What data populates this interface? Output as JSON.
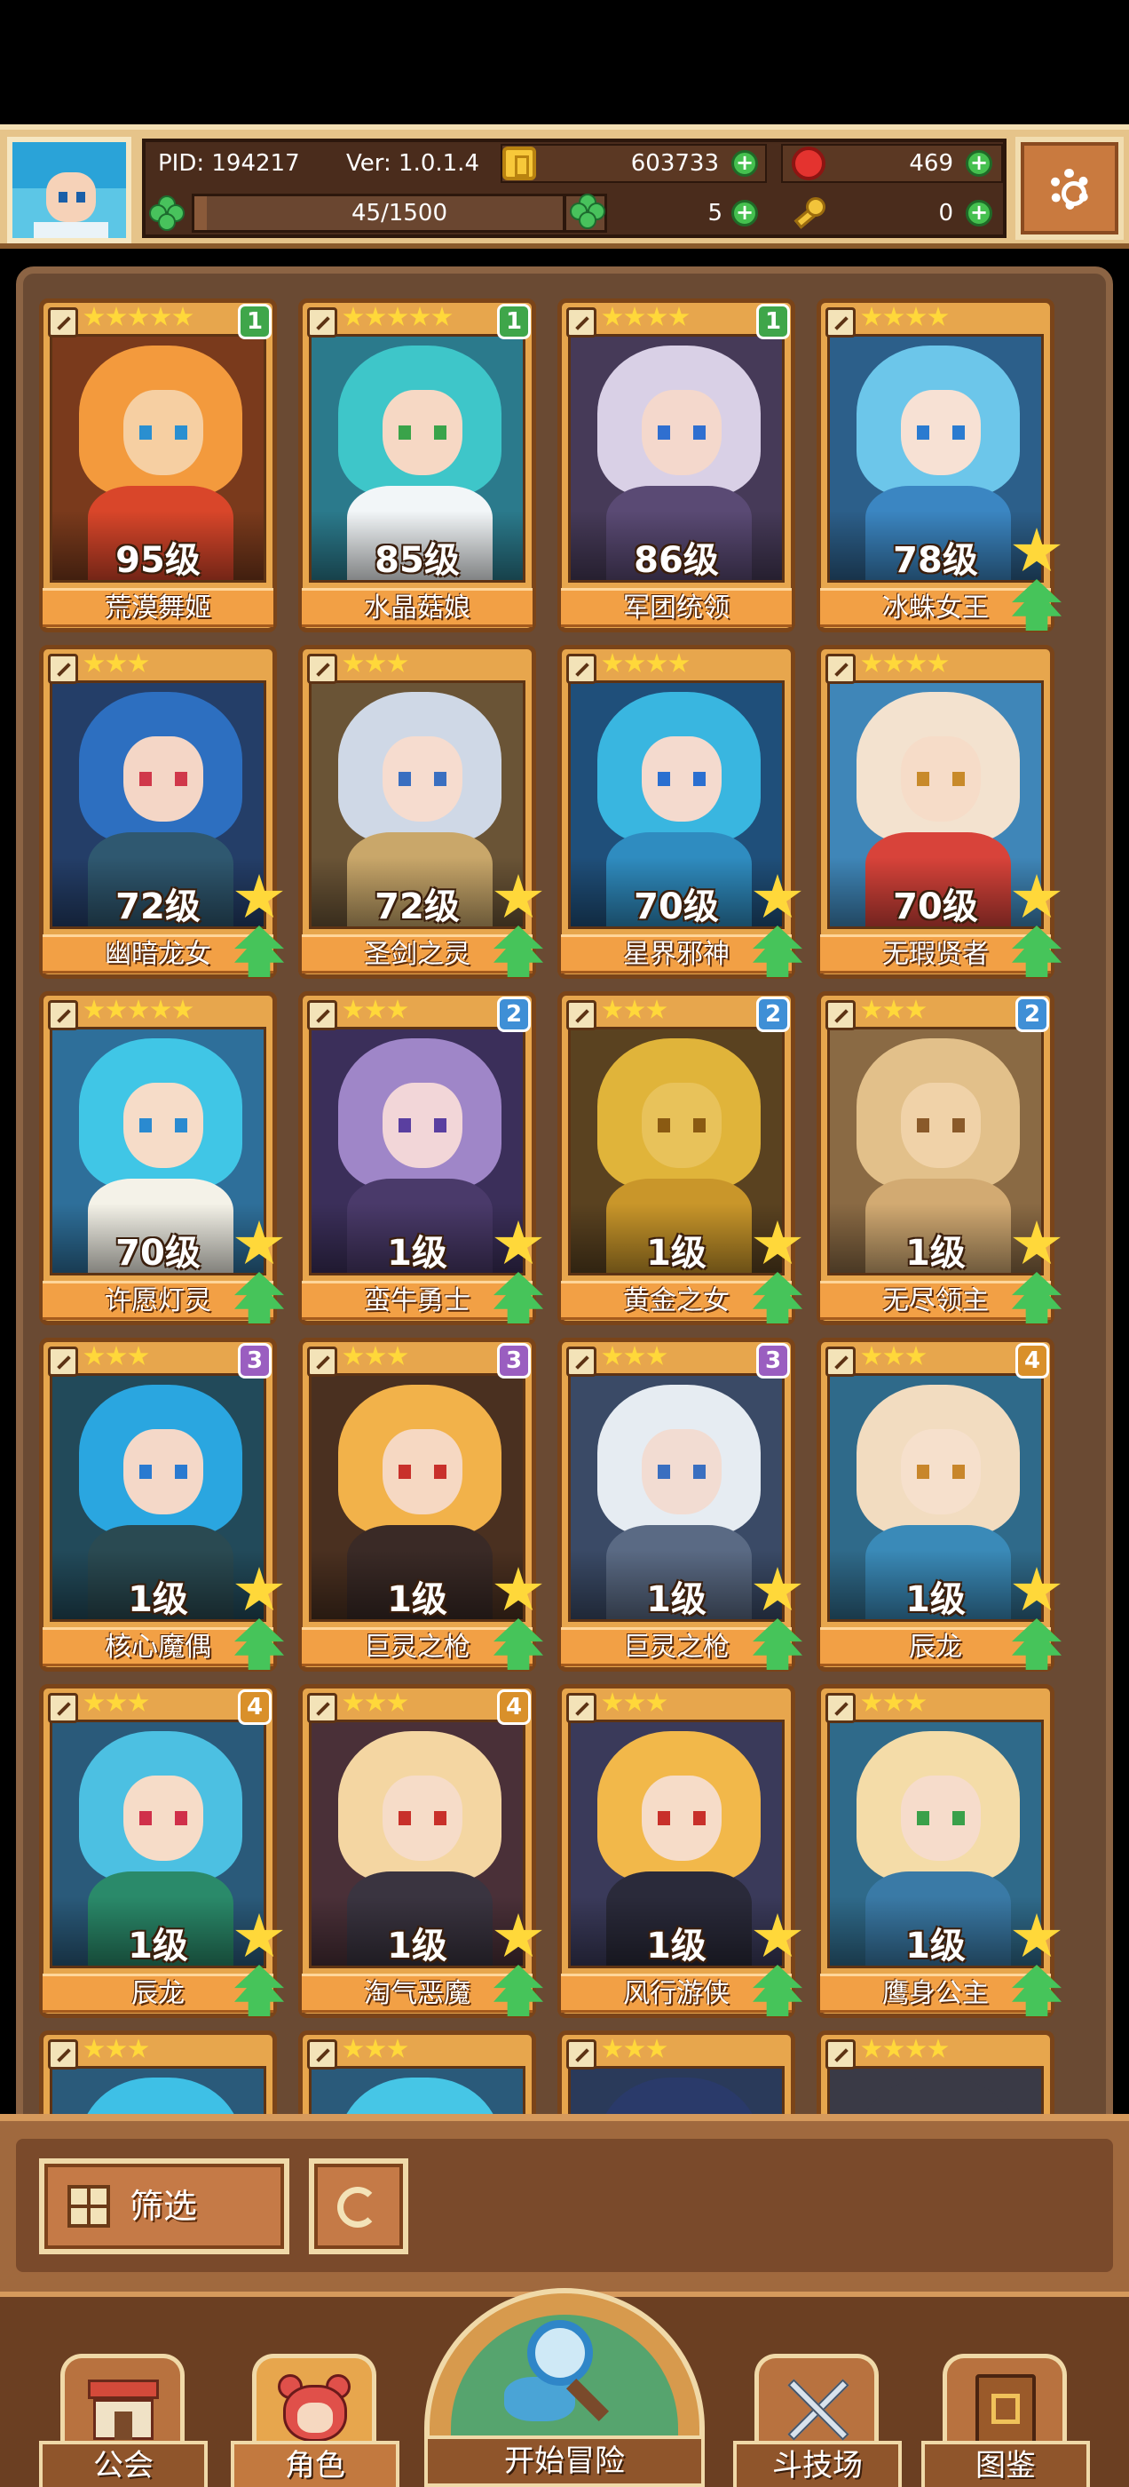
{
  "header": {
    "pid": "PID: 194217",
    "version": "Ver: 1.0.1.4",
    "gold": "603733",
    "gems": "469",
    "stamina": "45/1500",
    "stamina_fraction": 0.03,
    "clover": "5",
    "keys": "0"
  },
  "heroes": [
    {
      "name": "荒漠舞姬",
      "level": "95级",
      "stars": 5,
      "badge": "1",
      "badge_color": "#3fa64a",
      "hair": "#f39a3d",
      "skin": "#f6cfa2",
      "eyes": "#2a8fd0",
      "outfit": "#d9462a",
      "bg": "#7a3a1c",
      "upgrade": false
    },
    {
      "name": "水晶菇娘",
      "level": "85级",
      "stars": 5,
      "badge": "1",
      "badge_color": "#3fa64a",
      "hair": "#3ec6c9",
      "skin": "#f6d8c4",
      "eyes": "#3aa34a",
      "outfit": "#f2f6f8",
      "bg": "#2b7a8c",
      "upgrade": false
    },
    {
      "name": "军团统领",
      "level": "86级",
      "stars": 4,
      "badge": "1",
      "badge_color": "#3fa64a",
      "hair": "#d9d0e6",
      "skin": "#f4d8cc",
      "eyes": "#2f6fd0",
      "outfit": "#5a4a74",
      "bg": "#463a58",
      "upgrade": false
    },
    {
      "name": "冰蛛女王",
      "level": "78级",
      "stars": 4,
      "badge": "",
      "badge_color": "",
      "hair": "#6cc6ea",
      "skin": "#f7e1d4",
      "eyes": "#2a7bd0",
      "outfit": "#3b86c2",
      "bg": "#2c5f8a",
      "upgrade": true
    },
    {
      "name": "幽暗龙女",
      "level": "72级",
      "stars": 3,
      "badge": "",
      "badge_color": "",
      "hair": "#2d6fc0",
      "skin": "#f4d6c6",
      "eyes": "#d0384a",
      "outfit": "#2f5870",
      "bg": "#243e68",
      "upgrade": true
    },
    {
      "name": "圣剑之灵",
      "level": "72级",
      "stars": 3,
      "badge": "",
      "badge_color": "",
      "hair": "#cfd8e6",
      "skin": "#f6dccf",
      "eyes": "#3a6fc0",
      "outfit": "#c9a76a",
      "bg": "#6a5436",
      "upgrade": true
    },
    {
      "name": "星界邪神",
      "level": "70级",
      "stars": 4,
      "badge": "",
      "badge_color": "",
      "hair": "#39b6e0",
      "skin": "#f4dace",
      "eyes": "#2a6fd0",
      "outfit": "#2f8cc0",
      "bg": "#1f4f7a",
      "upgrade": true
    },
    {
      "name": "无瑕贤者",
      "level": "70级",
      "stars": 4,
      "badge": "",
      "badge_color": "",
      "hair": "#f3e2cf",
      "skin": "#f6dcc8",
      "eyes": "#c88a2a",
      "outfit": "#d8433a",
      "bg": "#3f86b8",
      "upgrade": true
    },
    {
      "name": "许愿灯灵",
      "level": "70级",
      "stars": 5,
      "badge": "",
      "badge_color": "",
      "hair": "#40c6e6",
      "skin": "#f6dcc8",
      "eyes": "#2a8ad0",
      "outfit": "#f4f2e8",
      "bg": "#2e6f9a",
      "upgrade": true
    },
    {
      "name": "蛮牛勇士",
      "level": "1级",
      "stars": 3,
      "badge": "2",
      "badge_color": "#3f8fd6",
      "hair": "#9f86c8",
      "skin": "#f2d6d8",
      "eyes": "#5a3fa0",
      "outfit": "#4a3a6a",
      "bg": "#3b2f5a",
      "upgrade": true
    },
    {
      "name": "黄金之女",
      "level": "1级",
      "stars": 3,
      "badge": "2",
      "badge_color": "#3f8fd6",
      "hair": "#e0b43a",
      "skin": "#e8c25a",
      "eyes": "#8a5a12",
      "outfit": "#c9962a",
      "bg": "#5a4220",
      "upgrade": true
    },
    {
      "name": "无尽领主",
      "level": "1级",
      "stars": 3,
      "badge": "2",
      "badge_color": "#3f8fd6",
      "hair": "#e2c08a",
      "skin": "#f0d2a8",
      "eyes": "#8a5a2a",
      "outfit": "#d2aa72",
      "bg": "#8a6a44",
      "upgrade": true
    },
    {
      "name": "核心魔偶",
      "level": "1级",
      "stars": 3,
      "badge": "3",
      "badge_color": "#9a5ec0",
      "hair": "#2aa6e0",
      "skin": "#f4d8c8",
      "eyes": "#2a7ad0",
      "outfit": "#2a4a52",
      "bg": "#224a5a",
      "upgrade": true
    },
    {
      "name": "巨灵之枪",
      "level": "1级",
      "stars": 3,
      "badge": "3",
      "badge_color": "#9a5ec0",
      "hair": "#f2b24a",
      "skin": "#f6d8c2",
      "eyes": "#c8302a",
      "outfit": "#3a2a26",
      "bg": "#4a3020",
      "upgrade": true
    },
    {
      "name": "巨灵之枪",
      "level": "1级",
      "stars": 3,
      "badge": "3",
      "badge_color": "#9a5ec0",
      "hair": "#e6ecf2",
      "skin": "#f2dcd2",
      "eyes": "#3a6fc0",
      "outfit": "#5a6a84",
      "bg": "#3a4a66",
      "upgrade": true
    },
    {
      "name": "辰龙",
      "level": "1级",
      "stars": 3,
      "badge": "4",
      "badge_color": "#d9902a",
      "hair": "#f2dcc0",
      "skin": "#f6e0cc",
      "eyes": "#c8862a",
      "outfit": "#3a8ab8",
      "bg": "#2f6a8a",
      "upgrade": true
    },
    {
      "name": "辰龙",
      "level": "1级",
      "stars": 3,
      "badge": "4",
      "badge_color": "#d9902a",
      "hair": "#4cc0e2",
      "skin": "#f6dcc8",
      "eyes": "#d0304a",
      "outfit": "#2a8a6a",
      "bg": "#2a5a7a",
      "upgrade": true
    },
    {
      "name": "淘气恶魔",
      "level": "1级",
      "stars": 3,
      "badge": "4",
      "badge_color": "#d9902a",
      "hair": "#f4d6a2",
      "skin": "#f6dcc8",
      "eyes": "#c8302a",
      "outfit": "#3a3440",
      "bg": "#4a3038",
      "upgrade": true
    },
    {
      "name": "风行游侠",
      "level": "1级",
      "stars": 3,
      "badge": "",
      "badge_color": "",
      "hair": "#f2b84a",
      "skin": "#f6dcc8",
      "eyes": "#c8302a",
      "outfit": "#2a2a3a",
      "bg": "#3a3a5a",
      "upgrade": true
    },
    {
      "name": "鹰身公主",
      "level": "1级",
      "stars": 3,
      "badge": "",
      "badge_color": "",
      "hair": "#f4dca8",
      "skin": "#f6dccb",
      "eyes": "#3aa04a",
      "outfit": "#3a7aa6",
      "bg": "#2f6a8a",
      "upgrade": true
    },
    {
      "name": "",
      "level": "",
      "stars": 3,
      "badge": "",
      "badge_color": "",
      "hair": "#3ec0e6",
      "skin": "#f6dcc8",
      "eyes": "#2a7ad0",
      "outfit": "#2a6a9a",
      "bg": "#2a5a7a",
      "upgrade": false
    },
    {
      "name": "",
      "level": "",
      "stars": 3,
      "badge": "",
      "badge_color": "",
      "hair": "#46c6e6",
      "skin": "#f6dcc8",
      "eyes": "#2a7ad0",
      "outfit": "#2a6a9a",
      "bg": "#2a5a7a",
      "upgrade": false
    },
    {
      "name": "",
      "level": "",
      "stars": 3,
      "badge": "",
      "badge_color": "",
      "hair": "#2a3a6a",
      "skin": "#f6dcc8",
      "eyes": "#2a7ad0",
      "outfit": "#2a3a5a",
      "bg": "#2a3a5a",
      "upgrade": false
    },
    {
      "name": "",
      "level": "",
      "stars": 4,
      "badge": "",
      "badge_color": "",
      "hair": "#3a3a46",
      "skin": "#f6dcc8",
      "eyes": "#2a7ad0",
      "outfit": "#3a3a46",
      "bg": "#3a3a46",
      "upgrade": false
    }
  ],
  "filter": {
    "label": "筛选"
  },
  "nav": {
    "guild": "公会",
    "heroes": "角色",
    "adventure": "开始冒险",
    "arena": "斗技场",
    "codex": "图鉴"
  }
}
